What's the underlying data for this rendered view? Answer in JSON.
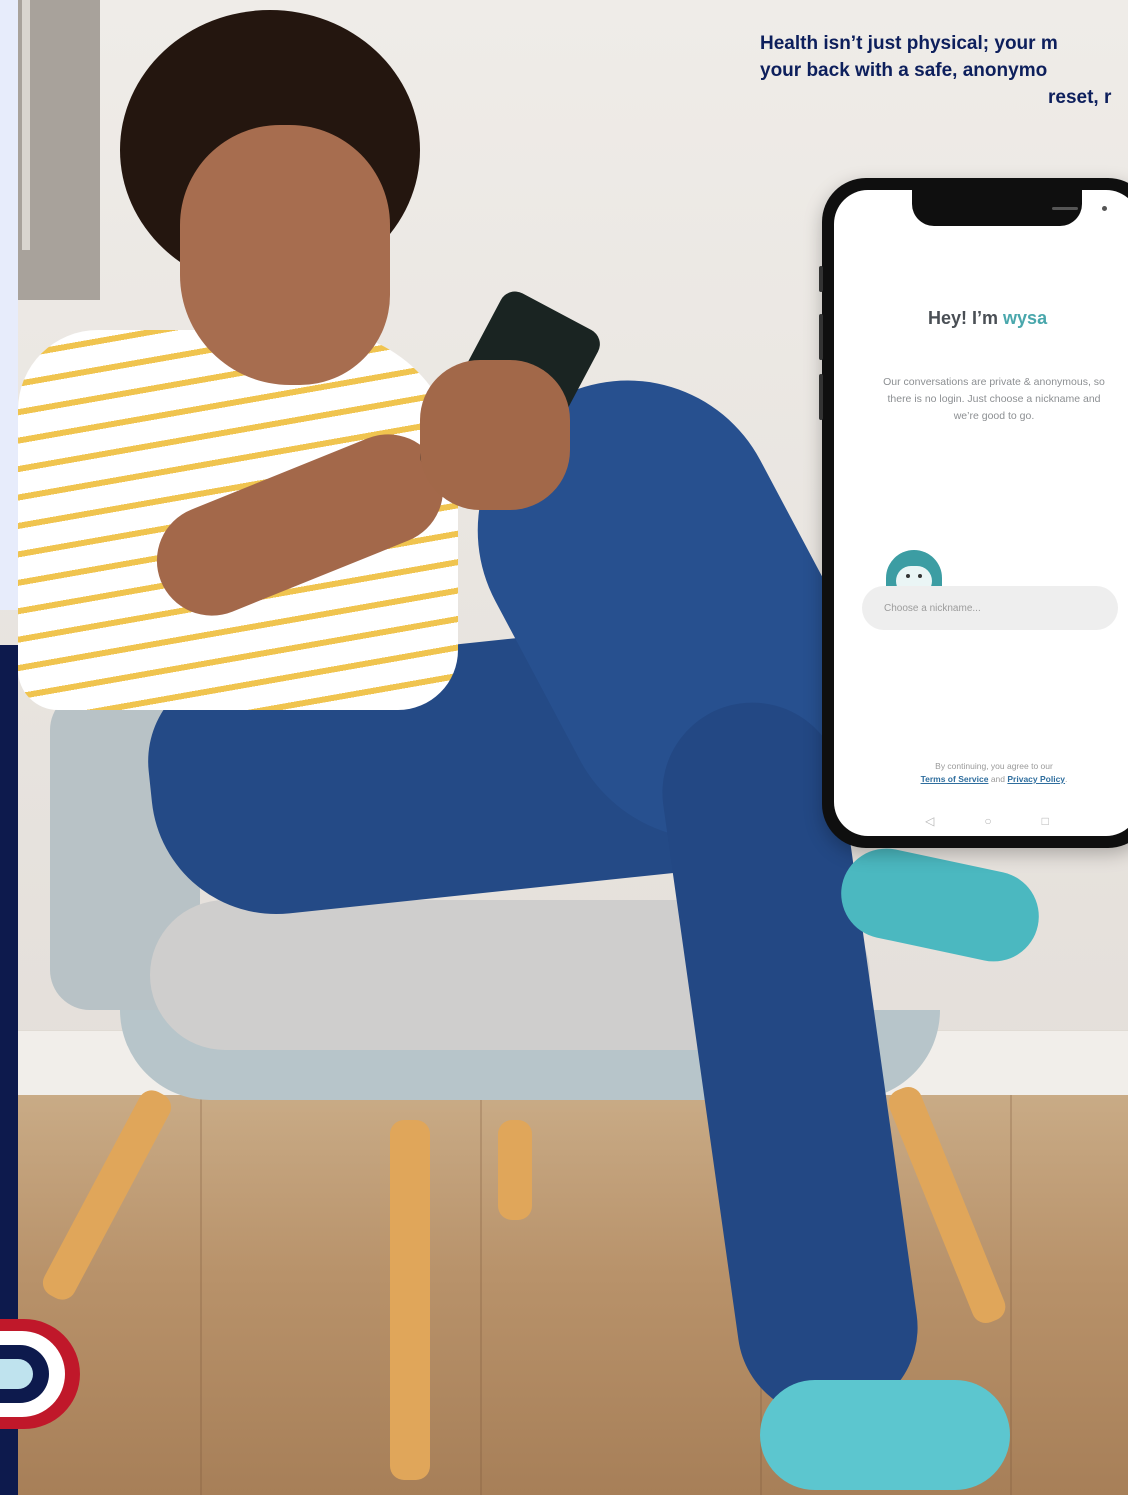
{
  "headline": {
    "line1": "Health isn’t just physical; your m",
    "line2": "your back with a safe, anonymo",
    "line3": "reset, r"
  },
  "phone": {
    "greeting_prefix": "Hey! I’m",
    "brand": "wysa",
    "intro": "Our conversations are private & anonymous, so there is no login. Just choose a nickname and we’re good to go.",
    "nickname_placeholder": "Choose a nickname...",
    "terms_prefix": "By continuing, you agree to our",
    "terms_link": "Terms of Service",
    "terms_and": "and",
    "privacy_link": "Privacy Policy",
    "terms_suffix": ".",
    "nav": {
      "back_glyph": "◁",
      "home_glyph": "○",
      "recent_glyph": "□"
    }
  },
  "colors": {
    "headline": "#0d1f5c",
    "brand_teal": "#49a7ac",
    "left_panel_dark": "#0d1a4d",
    "logo_red": "#c0182a"
  },
  "icons": {
    "mascot": "penguin-mascot-icon",
    "logo": "brand-logo-icon"
  }
}
